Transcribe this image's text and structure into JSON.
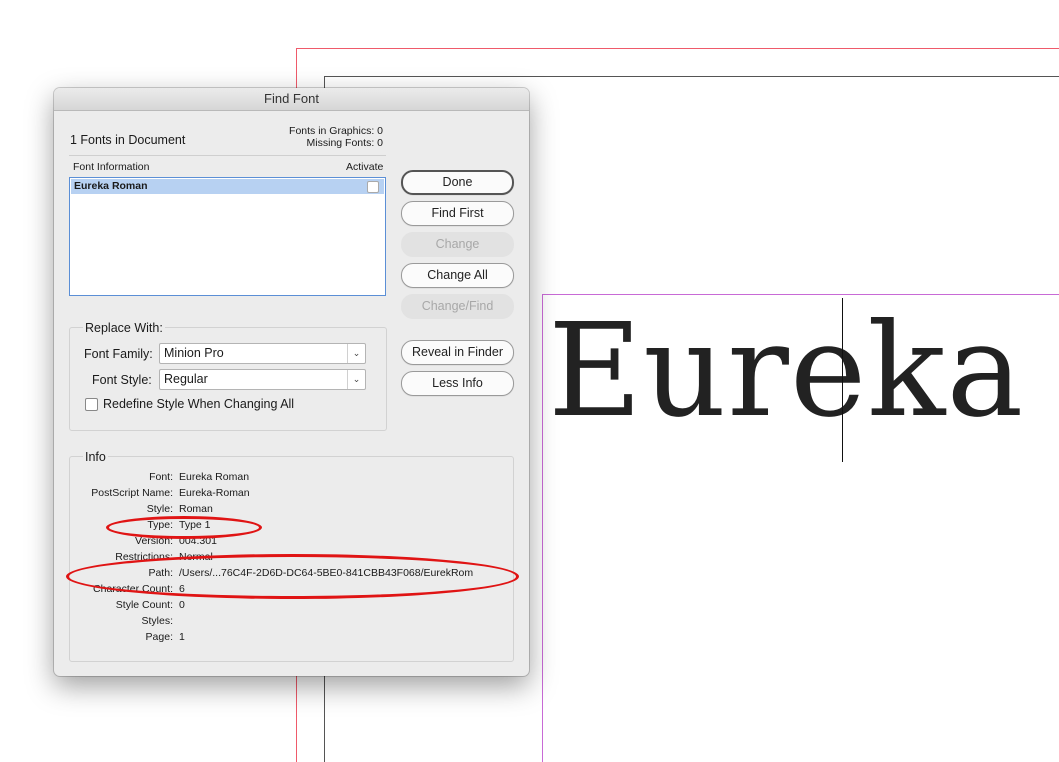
{
  "document": {
    "text": "Eureka"
  },
  "dialog": {
    "title": "Find Font",
    "fonts_in_document": "1 Fonts in Document",
    "fonts_in_graphics": "Fonts in Graphics: 0",
    "missing_fonts": "Missing Fonts: 0",
    "list_header_font_info": "Font Information",
    "list_header_activate": "Activate",
    "font_list": [
      {
        "name": "Eureka Roman",
        "selected": true
      }
    ],
    "buttons": {
      "done": "Done",
      "find_first": "Find First",
      "change": "Change",
      "change_all": "Change All",
      "change_find": "Change/Find",
      "reveal_in_finder": "Reveal in Finder",
      "less_info": "Less Info"
    },
    "replace_with": {
      "title": "Replace With:",
      "font_family_label": "Font Family:",
      "font_family_value": "Minion Pro",
      "font_style_label": "Font Style:",
      "font_style_value": "Regular",
      "redefine_label": "Redefine Style When Changing All",
      "redefine_checked": false
    },
    "info": {
      "title": "Info",
      "rows": [
        {
          "key": "Font:",
          "value": "Eureka Roman"
        },
        {
          "key": "PostScript Name:",
          "value": "Eureka-Roman"
        },
        {
          "key": "Style:",
          "value": "Roman"
        },
        {
          "key": "Type:",
          "value": "Type 1"
        },
        {
          "key": "Version:",
          "value": "004.301"
        },
        {
          "key": "Restrictions:",
          "value": "Normal"
        },
        {
          "key": "Path:",
          "value": "/Users/...76C4F-2D6D-DC64-5BE0-841CBB43F068/EurekRom"
        },
        {
          "key": "Character Count:",
          "value": "6"
        },
        {
          "key": "Style Count:",
          "value": "0"
        },
        {
          "key": "Styles:",
          "value": ""
        },
        {
          "key": "Page:",
          "value": "1"
        }
      ]
    }
  },
  "colors": {
    "annotation_red": "#e01414",
    "selection_blue": "#b7d1f2",
    "frame_magenta": "#c86ad6"
  }
}
